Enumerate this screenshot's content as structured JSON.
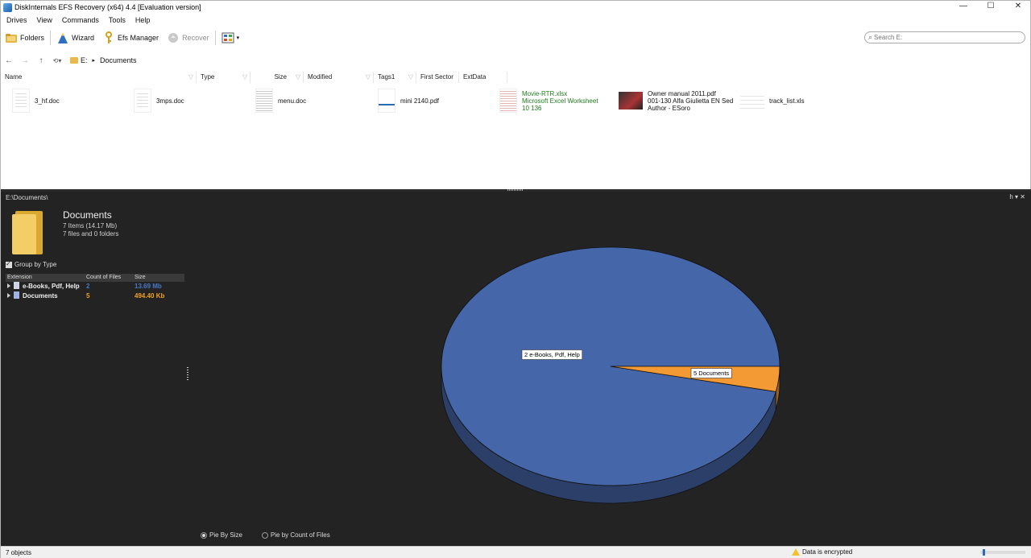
{
  "window": {
    "title": "DiskInternals EFS Recovery (x64) 4.4 [Evaluation version]",
    "controls": [
      "—",
      "☐",
      "✕"
    ]
  },
  "menu": [
    "Drives",
    "View",
    "Commands",
    "Tools",
    "Help"
  ],
  "toolbar": {
    "folders": "Folders",
    "wizard": "Wizard",
    "efs_manager": "Efs Manager",
    "recover": "Recover",
    "search_placeholder": "Search E:"
  },
  "nav": {
    "drive": "E:",
    "separator": "▸",
    "folder": "Documents"
  },
  "columns": [
    "Name",
    "Type",
    "Size",
    "Modified",
    "Tags1",
    "First Sector",
    "ExtData"
  ],
  "files": [
    {
      "name": "3_hf.doc",
      "thumb": "doc"
    },
    {
      "name": "3mps.doc",
      "thumb": "doc"
    },
    {
      "name": "menu.doc",
      "thumb": "menu"
    },
    {
      "name": "mini 2140.pdf",
      "thumb": "pdf"
    },
    {
      "name": "Movie-RTR.xlsx",
      "line2": "Microsoft Excel Worksheet",
      "line3": "10 136",
      "thumb": "xls"
    },
    {
      "name": "Owner manual 2011.pdf",
      "line2": "001-130 Alfa Giulietta EN Sed",
      "line3": "Author - ESoro",
      "thumb": "img"
    },
    {
      "name": "track_list.xls",
      "thumb": "track"
    }
  ],
  "details": {
    "path": "E:\\Documents\\",
    "pane_control": "h ▾ ✕",
    "title": "Documents",
    "items": "7 Items (14.17 Mb)",
    "files_folders": "7 files and 0 folders",
    "group_by_label": "Group by Type",
    "group_by_checked": true,
    "table_headers": [
      "Extension",
      "Count of Files",
      "Size"
    ],
    "groups": [
      {
        "name": "e-Books, Pdf, Help",
        "count": "2",
        "size": "13.69 Mb",
        "color": "#4a78c8"
      },
      {
        "name": "Documents",
        "count": "5",
        "size": "494.40 Kb",
        "color": "#f0a020"
      }
    ],
    "pie_mode_size": "Pie By Size",
    "pie_mode_count": "Pie by Count of Files",
    "selected_mode": "size"
  },
  "chart_data": {
    "type": "pie",
    "slices": [
      {
        "label": "2 e-Books, Pdf, Help",
        "value": 13.69,
        "unit": "Mb",
        "color": "#4566a8"
      },
      {
        "label": "5 Documents",
        "value": 0.4828,
        "unit": "Mb",
        "color": "#f39a34"
      }
    ],
    "style": "3d",
    "legend": "labels on slices"
  },
  "status": {
    "objects": "7 objects",
    "encrypted": "Data is encrypted",
    "zoom_level": 0.05
  }
}
